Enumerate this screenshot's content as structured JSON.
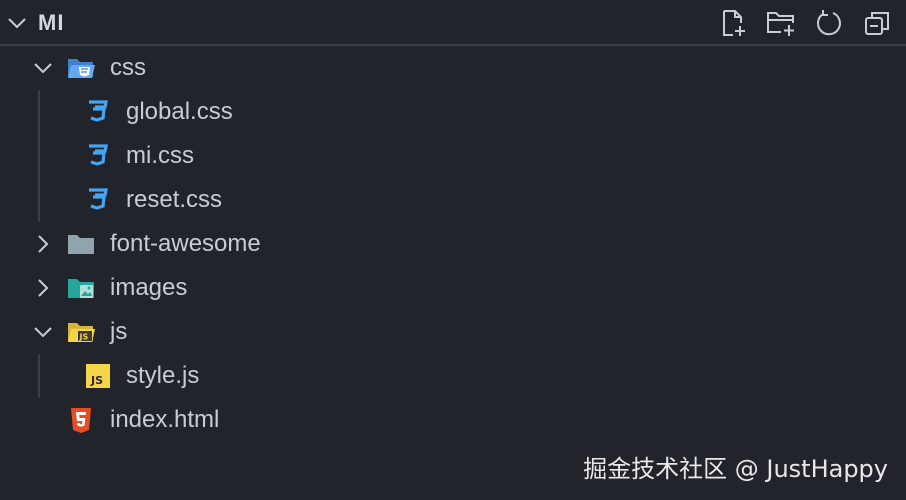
{
  "explorer": {
    "title": "MI",
    "toolbar": {
      "icons": [
        "new-file-icon",
        "new-folder-icon",
        "refresh-icon",
        "collapse-all-icon"
      ]
    }
  },
  "tree": {
    "css_folder": "css",
    "css_files": [
      "global.css",
      "mi.css",
      "reset.css"
    ],
    "font_awesome_folder": "font-awesome",
    "images_folder": "images",
    "js_folder": "js",
    "js_files": [
      "style.js"
    ],
    "index_file": "index.html"
  },
  "watermark": "掘金技术社区 @ JustHappy",
  "colors": {
    "background": "#21252b",
    "css_icon": "#42a5f5",
    "js_icon": "#f5d547",
    "html_icon": "#e44d26",
    "folder_grey": "#90a4ae",
    "images_folder": "#26a69a"
  }
}
